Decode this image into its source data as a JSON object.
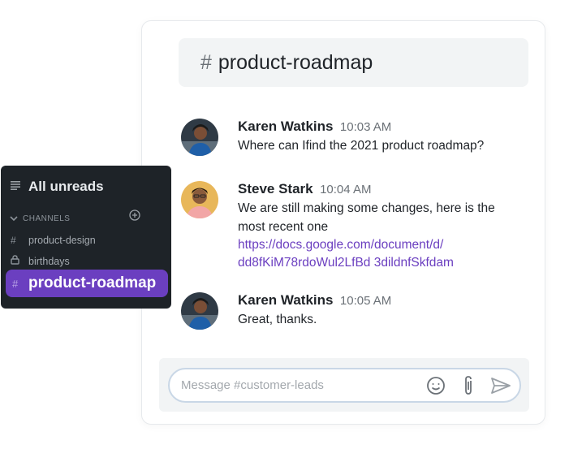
{
  "channel": {
    "hash": "#",
    "name": "product-roadmap"
  },
  "messages": [
    {
      "author": "Karen Watkins",
      "time": "10:03 AM",
      "lines": [
        "Where can Ifind the 2021 product roadmap?"
      ],
      "link": []
    },
    {
      "author": "Steve Stark",
      "time": "10:04 AM",
      "lines": [
        "We are still making some changes, here is the",
        "most recent one"
      ],
      "link": [
        "https://docs.google.com/document/d/",
        "dd8fKiM78rdoWul2LfBd 3dildnfSkfdam"
      ]
    },
    {
      "author": "Karen Watkins",
      "time": "10:05 AM",
      "lines": [
        "Great, thanks."
      ],
      "link": []
    }
  ],
  "composer": {
    "placeholder": "Message #customer-leads"
  },
  "sidebar": {
    "title": "All unreads",
    "section": "CHANNELS",
    "items": [
      {
        "glyph": "#",
        "name": "product-design"
      },
      {
        "glyph": "lock",
        "name": "birthdays"
      }
    ],
    "active": {
      "glyph": "#",
      "name": "product-roadmap"
    }
  },
  "colors": {
    "accent": "#6b3fc0",
    "sidebar_bg": "#1e2328",
    "link": "#6b3fc0"
  },
  "icons": [
    "menu-icon",
    "chevron-down-icon",
    "add-circle-icon",
    "lock-icon",
    "emoji-icon",
    "paperclip-icon",
    "send-icon"
  ]
}
